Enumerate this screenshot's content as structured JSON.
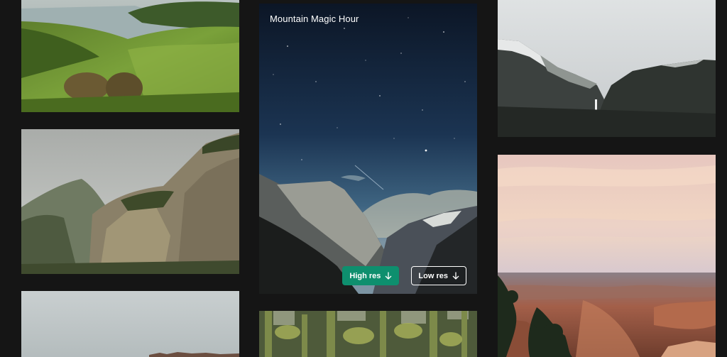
{
  "featured": {
    "title": "Mountain Magic Hour",
    "high_res_label": "High res",
    "low_res_label": "Low res",
    "download_icon": "arrow-down-icon"
  },
  "colors": {
    "background": "#151515",
    "accent": "#0e8f6e"
  }
}
